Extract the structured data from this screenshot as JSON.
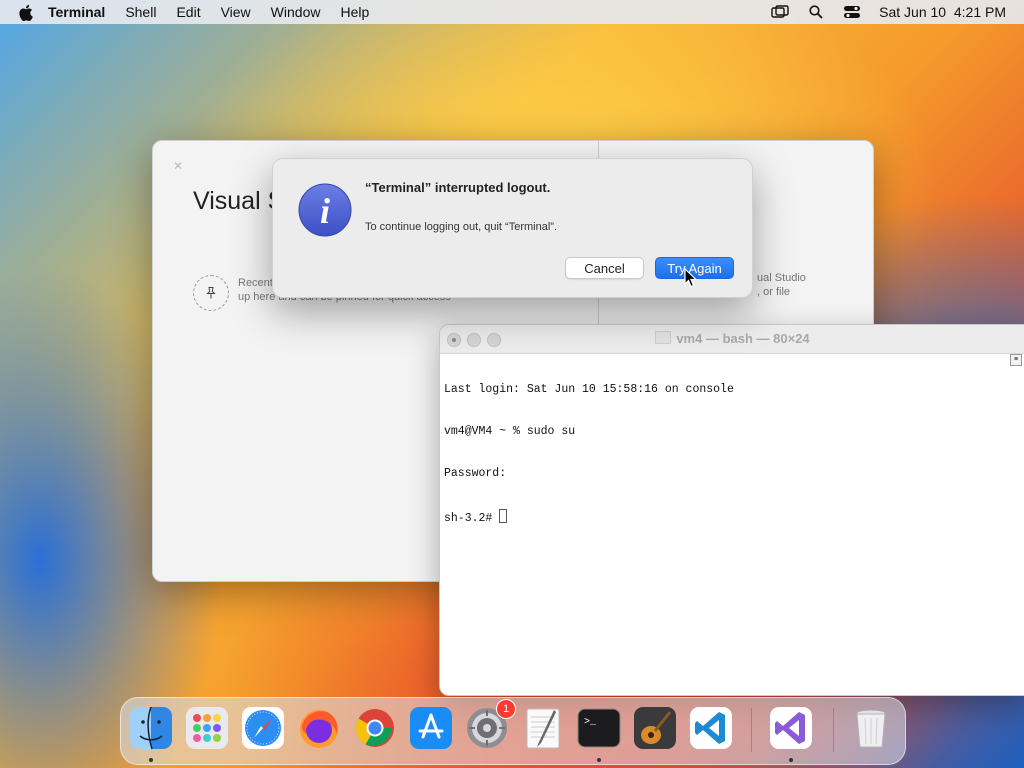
{
  "menubar": {
    "app": "Terminal",
    "items": [
      "Shell",
      "Edit",
      "View",
      "Window",
      "Help"
    ],
    "clock": "Sat Jun 10  4:21 PM"
  },
  "vs_window": {
    "title": "Visual S",
    "recent_line1": "Recent",
    "recent_line2": "up here and can be pinned for quick access",
    "right_line1": "ual Studio",
    "right_line2": ", or file"
  },
  "alert": {
    "title": "“Terminal” interrupted logout.",
    "message": "To continue logging out, quit “Terminal”.",
    "cancel_label": "Cancel",
    "confirm_label": "Try Again"
  },
  "terminal": {
    "title": "vm4 — bash — 80×24",
    "lines": [
      "Last login: Sat Jun 10 15:58:16 on console",
      "vm4@VM4 ~ % sudo su",
      "Password:",
      "sh-3.2# "
    ]
  },
  "dock": {
    "items": [
      "Finder",
      "Launchpad",
      "Safari",
      "Firefox",
      "Chrome",
      "App Store",
      "System Settings",
      "TextEdit",
      "Terminal",
      "GarageBand",
      "Visual Studio Code",
      "Visual Studio",
      "Trash"
    ],
    "settings_badge": "1"
  }
}
